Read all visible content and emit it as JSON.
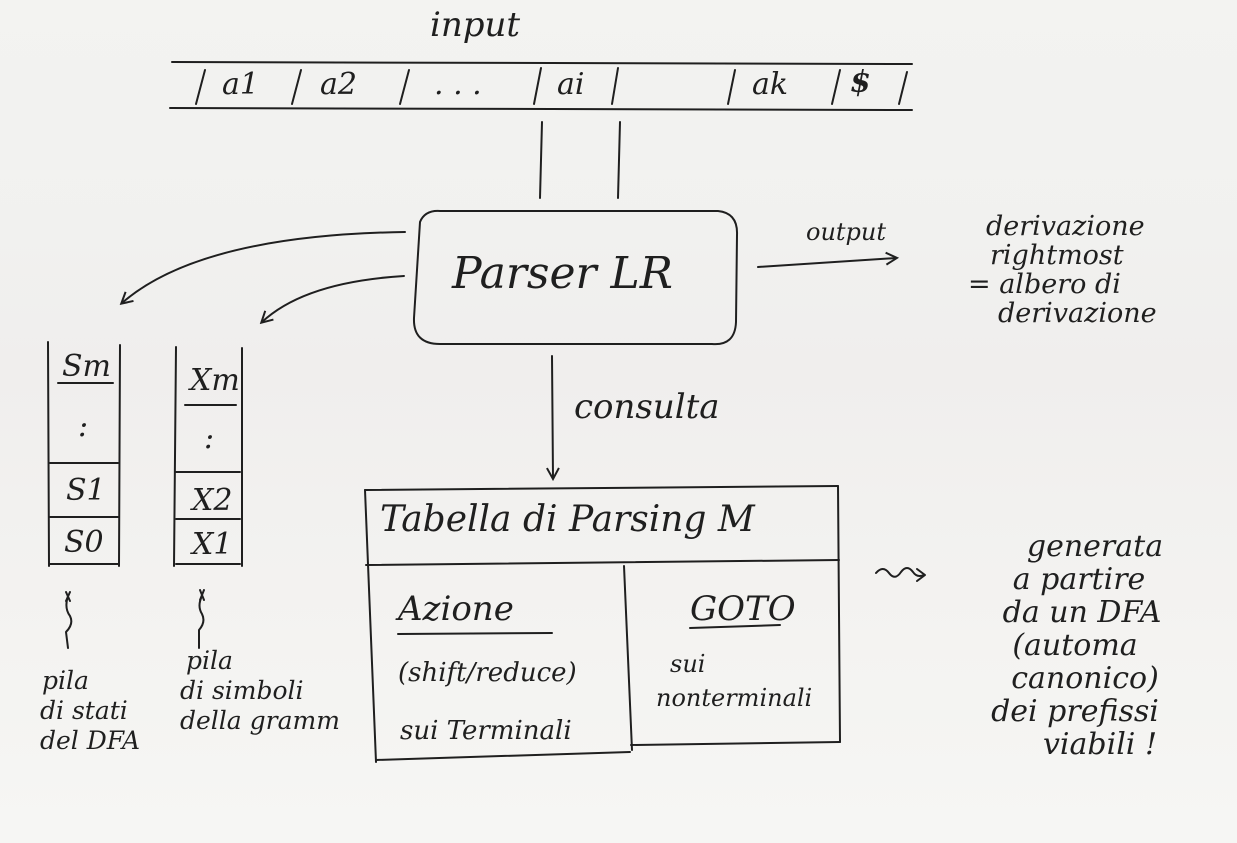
{
  "input": {
    "label": "input",
    "cells": [
      "a1",
      "a2",
      ". . .",
      "ai",
      "ak",
      "$"
    ]
  },
  "parser": {
    "label": "Parser LR"
  },
  "output": {
    "arrow_label": "output",
    "lines": [
      "derivazione",
      "rightmost",
      "= albero di",
      "derivazione"
    ]
  },
  "consult": {
    "label": "consulta"
  },
  "state_stack": {
    "cells": [
      "Sm",
      ":",
      "S1",
      "S0"
    ],
    "caption": [
      "pila",
      "di stati",
      "del DFA"
    ]
  },
  "symbol_stack": {
    "cells": [
      "Xm",
      ":",
      "X2",
      "X1"
    ],
    "caption": [
      "pila",
      "di simboli",
      "della gramm"
    ]
  },
  "table": {
    "title": "Tabella di Parsing M",
    "action": {
      "title": "Azione",
      "line1": "(shift/reduce)",
      "line2": "sui Terminali"
    },
    "goto": {
      "title": "GOTO",
      "line1": "sui",
      "line2": "nonterminali"
    }
  },
  "generated_note": [
    "generata",
    "a partire",
    "da un DFA",
    "(automa",
    "canonico)",
    "dei prefissi",
    "viabili !"
  ]
}
